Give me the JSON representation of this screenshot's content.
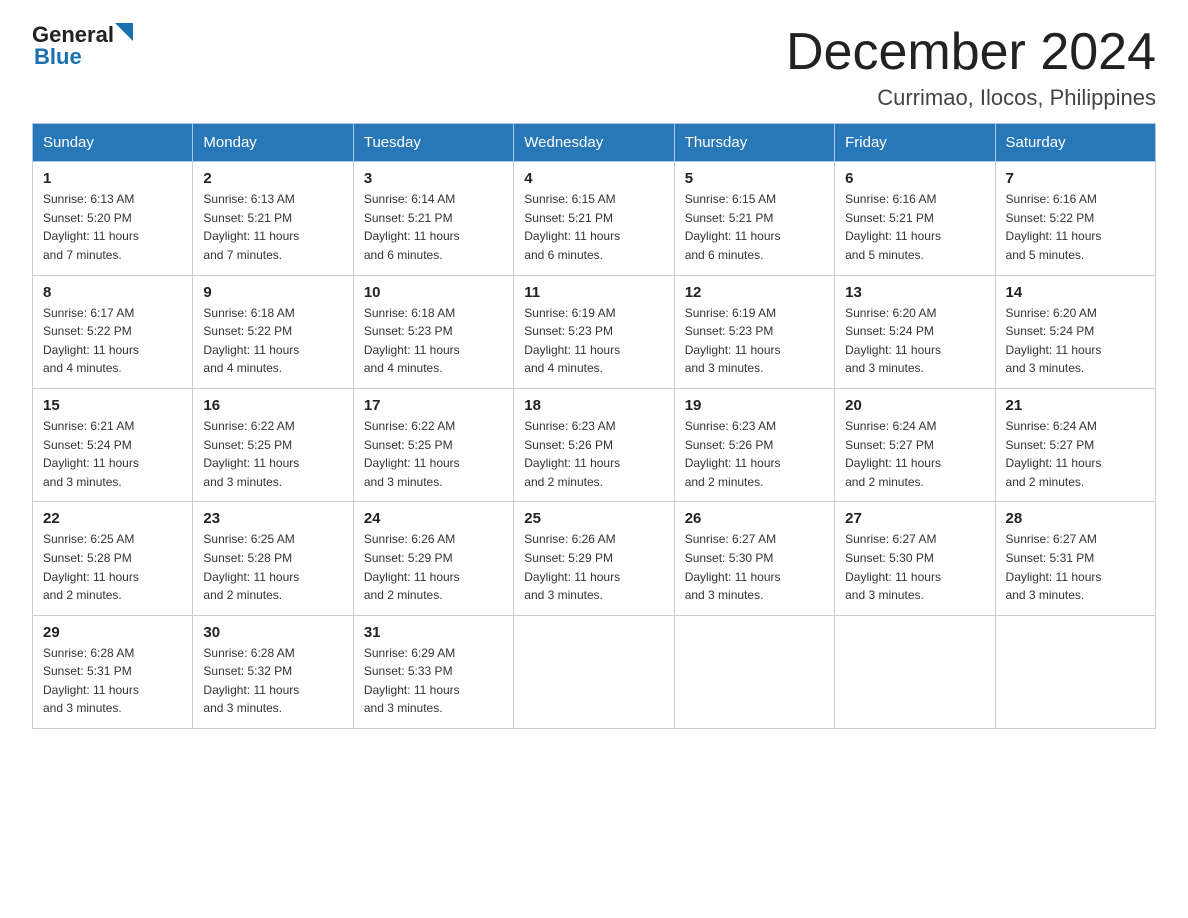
{
  "logo": {
    "general": "General",
    "blue": "Blue"
  },
  "header": {
    "month_year": "December 2024",
    "location": "Currimao, Ilocos, Philippines"
  },
  "days_of_week": [
    "Sunday",
    "Monday",
    "Tuesday",
    "Wednesday",
    "Thursday",
    "Friday",
    "Saturday"
  ],
  "weeks": [
    [
      {
        "day": "1",
        "sunrise": "6:13 AM",
        "sunset": "5:20 PM",
        "daylight": "11 hours and 7 minutes."
      },
      {
        "day": "2",
        "sunrise": "6:13 AM",
        "sunset": "5:21 PM",
        "daylight": "11 hours and 7 minutes."
      },
      {
        "day": "3",
        "sunrise": "6:14 AM",
        "sunset": "5:21 PM",
        "daylight": "11 hours and 6 minutes."
      },
      {
        "day": "4",
        "sunrise": "6:15 AM",
        "sunset": "5:21 PM",
        "daylight": "11 hours and 6 minutes."
      },
      {
        "day": "5",
        "sunrise": "6:15 AM",
        "sunset": "5:21 PM",
        "daylight": "11 hours and 6 minutes."
      },
      {
        "day": "6",
        "sunrise": "6:16 AM",
        "sunset": "5:21 PM",
        "daylight": "11 hours and 5 minutes."
      },
      {
        "day": "7",
        "sunrise": "6:16 AM",
        "sunset": "5:22 PM",
        "daylight": "11 hours and 5 minutes."
      }
    ],
    [
      {
        "day": "8",
        "sunrise": "6:17 AM",
        "sunset": "5:22 PM",
        "daylight": "11 hours and 4 minutes."
      },
      {
        "day": "9",
        "sunrise": "6:18 AM",
        "sunset": "5:22 PM",
        "daylight": "11 hours and 4 minutes."
      },
      {
        "day": "10",
        "sunrise": "6:18 AM",
        "sunset": "5:23 PM",
        "daylight": "11 hours and 4 minutes."
      },
      {
        "day": "11",
        "sunrise": "6:19 AM",
        "sunset": "5:23 PM",
        "daylight": "11 hours and 4 minutes."
      },
      {
        "day": "12",
        "sunrise": "6:19 AM",
        "sunset": "5:23 PM",
        "daylight": "11 hours and 3 minutes."
      },
      {
        "day": "13",
        "sunrise": "6:20 AM",
        "sunset": "5:24 PM",
        "daylight": "11 hours and 3 minutes."
      },
      {
        "day": "14",
        "sunrise": "6:20 AM",
        "sunset": "5:24 PM",
        "daylight": "11 hours and 3 minutes."
      }
    ],
    [
      {
        "day": "15",
        "sunrise": "6:21 AM",
        "sunset": "5:24 PM",
        "daylight": "11 hours and 3 minutes."
      },
      {
        "day": "16",
        "sunrise": "6:22 AM",
        "sunset": "5:25 PM",
        "daylight": "11 hours and 3 minutes."
      },
      {
        "day": "17",
        "sunrise": "6:22 AM",
        "sunset": "5:25 PM",
        "daylight": "11 hours and 3 minutes."
      },
      {
        "day": "18",
        "sunrise": "6:23 AM",
        "sunset": "5:26 PM",
        "daylight": "11 hours and 2 minutes."
      },
      {
        "day": "19",
        "sunrise": "6:23 AM",
        "sunset": "5:26 PM",
        "daylight": "11 hours and 2 minutes."
      },
      {
        "day": "20",
        "sunrise": "6:24 AM",
        "sunset": "5:27 PM",
        "daylight": "11 hours and 2 minutes."
      },
      {
        "day": "21",
        "sunrise": "6:24 AM",
        "sunset": "5:27 PM",
        "daylight": "11 hours and 2 minutes."
      }
    ],
    [
      {
        "day": "22",
        "sunrise": "6:25 AM",
        "sunset": "5:28 PM",
        "daylight": "11 hours and 2 minutes."
      },
      {
        "day": "23",
        "sunrise": "6:25 AM",
        "sunset": "5:28 PM",
        "daylight": "11 hours and 2 minutes."
      },
      {
        "day": "24",
        "sunrise": "6:26 AM",
        "sunset": "5:29 PM",
        "daylight": "11 hours and 2 minutes."
      },
      {
        "day": "25",
        "sunrise": "6:26 AM",
        "sunset": "5:29 PM",
        "daylight": "11 hours and 3 minutes."
      },
      {
        "day": "26",
        "sunrise": "6:27 AM",
        "sunset": "5:30 PM",
        "daylight": "11 hours and 3 minutes."
      },
      {
        "day": "27",
        "sunrise": "6:27 AM",
        "sunset": "5:30 PM",
        "daylight": "11 hours and 3 minutes."
      },
      {
        "day": "28",
        "sunrise": "6:27 AM",
        "sunset": "5:31 PM",
        "daylight": "11 hours and 3 minutes."
      }
    ],
    [
      {
        "day": "29",
        "sunrise": "6:28 AM",
        "sunset": "5:31 PM",
        "daylight": "11 hours and 3 minutes."
      },
      {
        "day": "30",
        "sunrise": "6:28 AM",
        "sunset": "5:32 PM",
        "daylight": "11 hours and 3 minutes."
      },
      {
        "day": "31",
        "sunrise": "6:29 AM",
        "sunset": "5:33 PM",
        "daylight": "11 hours and 3 minutes."
      },
      null,
      null,
      null,
      null
    ]
  ],
  "labels": {
    "sunrise": "Sunrise:",
    "sunset": "Sunset:",
    "daylight": "Daylight:"
  }
}
